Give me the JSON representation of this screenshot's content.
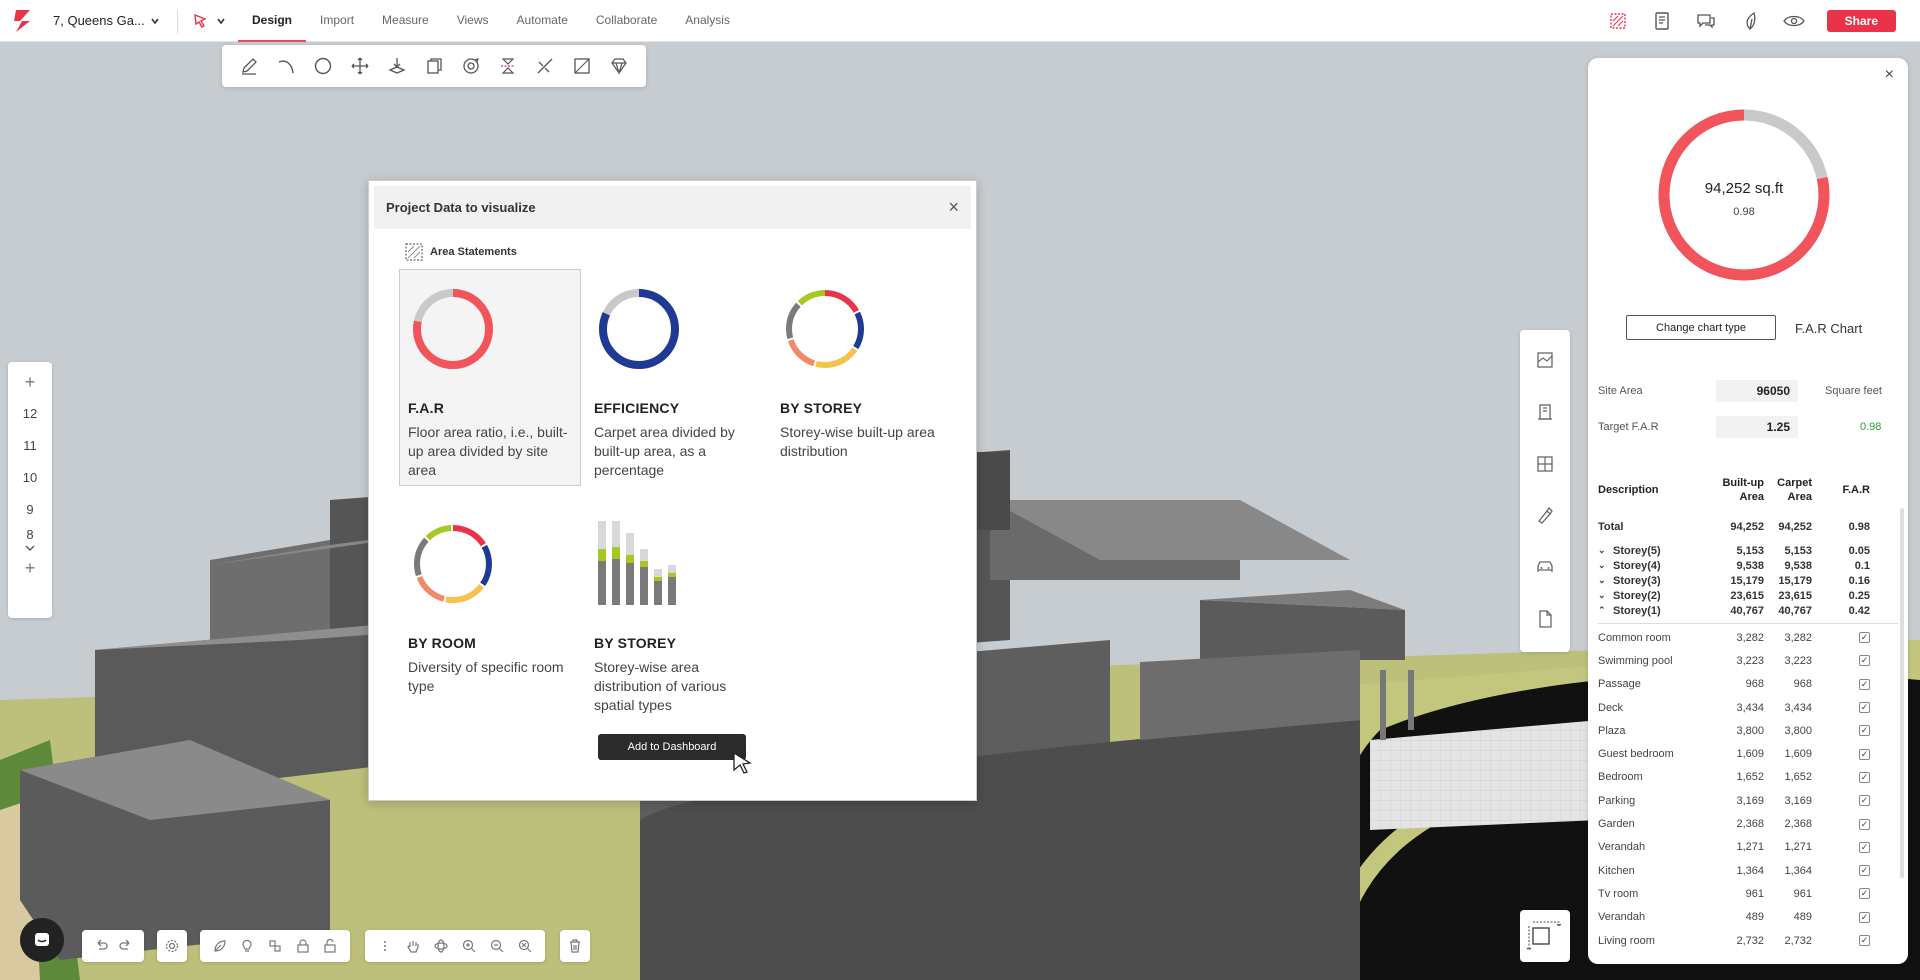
{
  "app": {
    "project_name": "7, Queens Ga...",
    "menus": [
      {
        "label": "Design",
        "active": true
      },
      {
        "label": "Import",
        "active": false
      },
      {
        "label": "Measure",
        "active": false
      },
      {
        "label": "Views",
        "active": false
      },
      {
        "label": "Automate",
        "active": false
      },
      {
        "label": "Collaborate",
        "active": false
      },
      {
        "label": "Analysis",
        "active": false
      }
    ],
    "share_label": "Share",
    "accent_color": "#e8334a"
  },
  "storey_panel": {
    "add_top": "+",
    "levels": [
      "12",
      "11",
      "10",
      "9",
      "8"
    ],
    "add_bottom": "+"
  },
  "modal": {
    "title": "Project Data to visualize",
    "close": "×",
    "section_title": "Area Statements",
    "cards": [
      {
        "title": "F.A.R",
        "desc": "Floor area ratio, i.e., built-up area divided by site area",
        "selected": true
      },
      {
        "title": "EFFICIENCY",
        "desc": "Carpet area divided by built-up area, as a percentage",
        "selected": false
      },
      {
        "title": "BY STOREY",
        "desc": "Storey-wise built-up area distribution",
        "selected": false
      },
      {
        "title": "BY ROOM",
        "desc": "Diversity of specific room type",
        "selected": false
      },
      {
        "title": "BY STOREY",
        "desc": "Storey-wise area distribution of various spatial types",
        "selected": false
      }
    ],
    "add_button": "Add to Dashboard"
  },
  "right_panel": {
    "close": "×",
    "donut_value": "94,252 sq.ft",
    "donut_ratio": "0.98",
    "far_fraction": 0.784,
    "colors": {
      "used": "#f2545b",
      "remaining": "#c9c9c9",
      "green": "#2a9d3a"
    },
    "change_chart_label": "Change chart type",
    "chart_name": "F.A.R Chart",
    "site_area_label": "Site Area",
    "site_area_value": "96050",
    "site_area_unit": "Square feet",
    "target_far_label": "Target F.A.R",
    "target_far_value": "1.25",
    "target_far_achieved": "0.98",
    "table": {
      "headers": {
        "description": "Description",
        "built_up": "Built-up Area",
        "carpet": "Carpet Area",
        "far": "F.A.R"
      },
      "total": {
        "label": "Total",
        "built_up": "94,252",
        "carpet": "94,252",
        "far": "0.98"
      },
      "storeys": [
        {
          "label": "Storey(5)",
          "built_up": "5,153",
          "carpet": "5,153",
          "far": "0.05",
          "chevron": "⌄"
        },
        {
          "label": "Storey(4)",
          "built_up": "9,538",
          "carpet": "9,538",
          "far": "0.1",
          "chevron": "⌄"
        },
        {
          "label": "Storey(3)",
          "built_up": "15,179",
          "carpet": "15,179",
          "far": "0.16",
          "chevron": "⌄"
        },
        {
          "label": "Storey(2)",
          "built_up": "23,615",
          "carpet": "23,615",
          "far": "0.25",
          "chevron": "⌄"
        },
        {
          "label": "Storey(1)",
          "built_up": "40,767",
          "carpet": "40,767",
          "far": "0.42",
          "chevron": "⌃"
        }
      ],
      "rooms": [
        {
          "label": "Common room",
          "built_up": "3,282",
          "carpet": "3,282"
        },
        {
          "label": "Swimming pool",
          "built_up": "3,223",
          "carpet": "3,223"
        },
        {
          "label": "Passage",
          "built_up": "968",
          "carpet": "968"
        },
        {
          "label": "Deck",
          "built_up": "3,434",
          "carpet": "3,434"
        },
        {
          "label": "Plaza",
          "built_up": "3,800",
          "carpet": "3,800"
        },
        {
          "label": "Guest bedroom",
          "built_up": "1,609",
          "carpet": "1,609"
        },
        {
          "label": "Bedroom",
          "built_up": "1,652",
          "carpet": "1,652"
        },
        {
          "label": "Parking",
          "built_up": "3,169",
          "carpet": "3,169"
        },
        {
          "label": "Garden",
          "built_up": "2,368",
          "carpet": "2,368"
        },
        {
          "label": "Verandah",
          "built_up": "1,271",
          "carpet": "1,271"
        },
        {
          "label": "Kitchen",
          "built_up": "1,364",
          "carpet": "1,364"
        },
        {
          "label": "Tv room",
          "built_up": "961",
          "carpet": "961"
        },
        {
          "label": "Verandah",
          "built_up": "489",
          "carpet": "489"
        },
        {
          "label": "Living room",
          "built_up": "2,732",
          "carpet": "2,732"
        }
      ],
      "checkbox_mark": "✓"
    }
  }
}
